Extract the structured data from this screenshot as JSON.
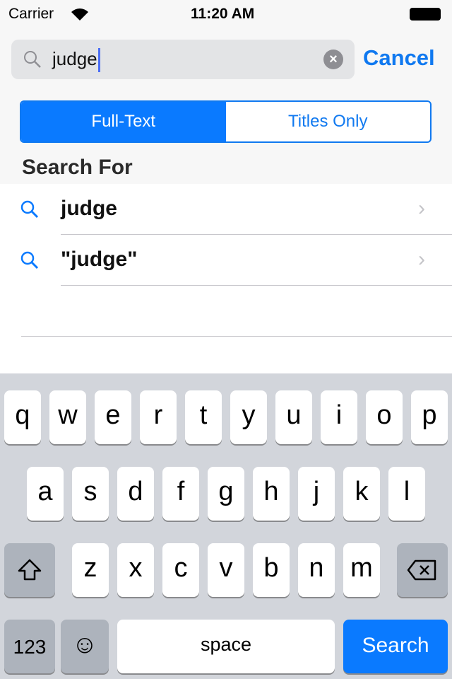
{
  "status": {
    "carrier": "Carrier",
    "time": "11:20 AM"
  },
  "search": {
    "query": "judge",
    "cancel_label": "Cancel"
  },
  "scope": {
    "options": [
      "Full-Text",
      "Titles Only"
    ],
    "selected": "Full-Text"
  },
  "section_header": "Search For",
  "suggestions": [
    {
      "text": "judge"
    },
    {
      "text": "\"judge\""
    }
  ],
  "keyboard": {
    "rows": [
      [
        "q",
        "w",
        "e",
        "r",
        "t",
        "y",
        "u",
        "i",
        "o",
        "p"
      ],
      [
        "a",
        "s",
        "d",
        "f",
        "g",
        "h",
        "j",
        "k",
        "l"
      ],
      [
        "z",
        "x",
        "c",
        "v",
        "b",
        "n",
        "m"
      ]
    ],
    "numbers_label": "123",
    "space_label": "space",
    "return_label": "Search"
  },
  "colors": {
    "accent": "#0a7aff"
  }
}
